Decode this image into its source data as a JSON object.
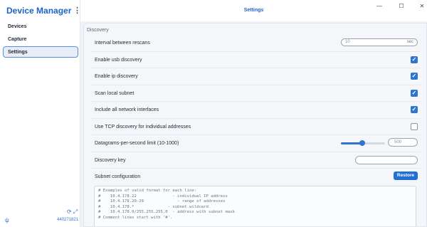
{
  "app": {
    "title": "Device Manager",
    "menu_icon": "kebab-icon"
  },
  "window": {
    "title": "Settings",
    "minimize": "—",
    "maximize": "☐",
    "close": "✕"
  },
  "sidebar": {
    "items": [
      {
        "label": "Devices",
        "active": false
      },
      {
        "label": "Capture",
        "active": false
      },
      {
        "label": "Settings",
        "active": true
      }
    ],
    "footer": {
      "serial": "440271821",
      "icons": [
        "refresh-icon",
        "expand-icon",
        "usb-icon"
      ]
    }
  },
  "settings": {
    "section_title": "Discovery",
    "rescan": {
      "label": "Interval between rescans",
      "value": "10",
      "unit": "sec"
    },
    "usb": {
      "label": "Enable usb discovery",
      "checked": true
    },
    "ip": {
      "label": "Enable ip discovery",
      "checked": true
    },
    "subnet_scan": {
      "label": "Scan local subnet",
      "checked": true
    },
    "all_interfaces": {
      "label": "Include all network interfaces",
      "checked": true
    },
    "tcp": {
      "label": "Use TCP discovery for individual addresses",
      "checked": false
    },
    "datagrams": {
      "label": "Datagrams-per-second limit (10-1000)",
      "value": "500",
      "slider_fraction": 0.49
    },
    "discovery_key": {
      "label": "Discovery key",
      "value": ""
    },
    "subnet": {
      "label": "Subnet configuration",
      "restore_label": "Restore",
      "lines": [
        "# Examples of valid format for each line:",
        "#    10.4.178.22               - individual IP address",
        "#    10.4.178.20-29              - range of addresses",
        "#    10.4.178.*              - subnet wildcard",
        "#    10.4.178.0/255.255.255.0  - address with subnet mask",
        "# Comment lines start with '#'."
      ]
    }
  },
  "colors": {
    "accent": "#2f74d0",
    "title": "#1f62c9"
  }
}
